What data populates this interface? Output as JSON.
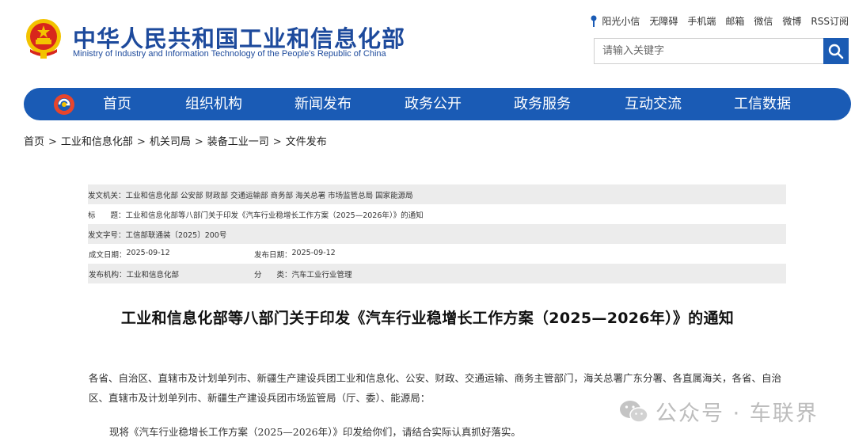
{
  "header": {
    "title": "中华人民共和国工业和信息化部",
    "subtitle": "Ministry of Industry and Information Technology of the People's Republic of China",
    "top_links": [
      "阳光小信",
      "无障碍",
      "手机端",
      "邮箱",
      "微信",
      "微博",
      "RSS订阅"
    ],
    "search_placeholder": "请输入关键字"
  },
  "nav": {
    "items": [
      "首页",
      "组织机构",
      "新闻发布",
      "政务公开",
      "政务服务",
      "互动交流",
      "工信数据"
    ]
  },
  "breadcrumb": [
    "首页",
    "工业和信息化部",
    "机关司局",
    "装备工业一司",
    "文件发布"
  ],
  "meta": {
    "issuer_label": "发文机关：",
    "issuer": "工业和信息化部 公安部 财政部 交通运输部 商务部 海关总署 市场监管总局 国家能源局",
    "title_label": "标　　题：",
    "title": "工业和信息化部等八部门关于印发《汽车行业稳增长工作方案（2025—2026年）》的通知",
    "docno_label": "发文字号：",
    "docno": "工信部联通装〔2025〕200号",
    "created_label": "成文日期：",
    "created": "2025-09-12",
    "published_label": "发布日期：",
    "published": "2025-09-12",
    "org_label": "发布机构：",
    "org": "工业和信息化部",
    "category_label": "分　　类：",
    "category": "汽车工业行业管理"
  },
  "doc": {
    "title": "工业和信息化部等八部门关于印发《汽车行业稳增长工作方案（2025—2026年）》的通知",
    "para1": "各省、自治区、直辖市及计划单列市、新疆生产建设兵团工业和信息化、公安、财政、交通运输、商务主管部门，海关总署广东分署、各直属海关，各省、自治区、直辖市及计划单列市、新疆生产建设兵团市场监管局（厅、委）、能源局：",
    "para2": "现将《汽车行业稳增长工作方案（2025—2026年）》印发给你们，请结合实际认真抓好落实。"
  },
  "watermark": "公众号 · 车联界",
  "colors": {
    "brand_blue": "#1a5bb5",
    "title_blue": "#1d4a9c",
    "emblem_red": "#d8261c",
    "emblem_gold": "#f3c300"
  }
}
